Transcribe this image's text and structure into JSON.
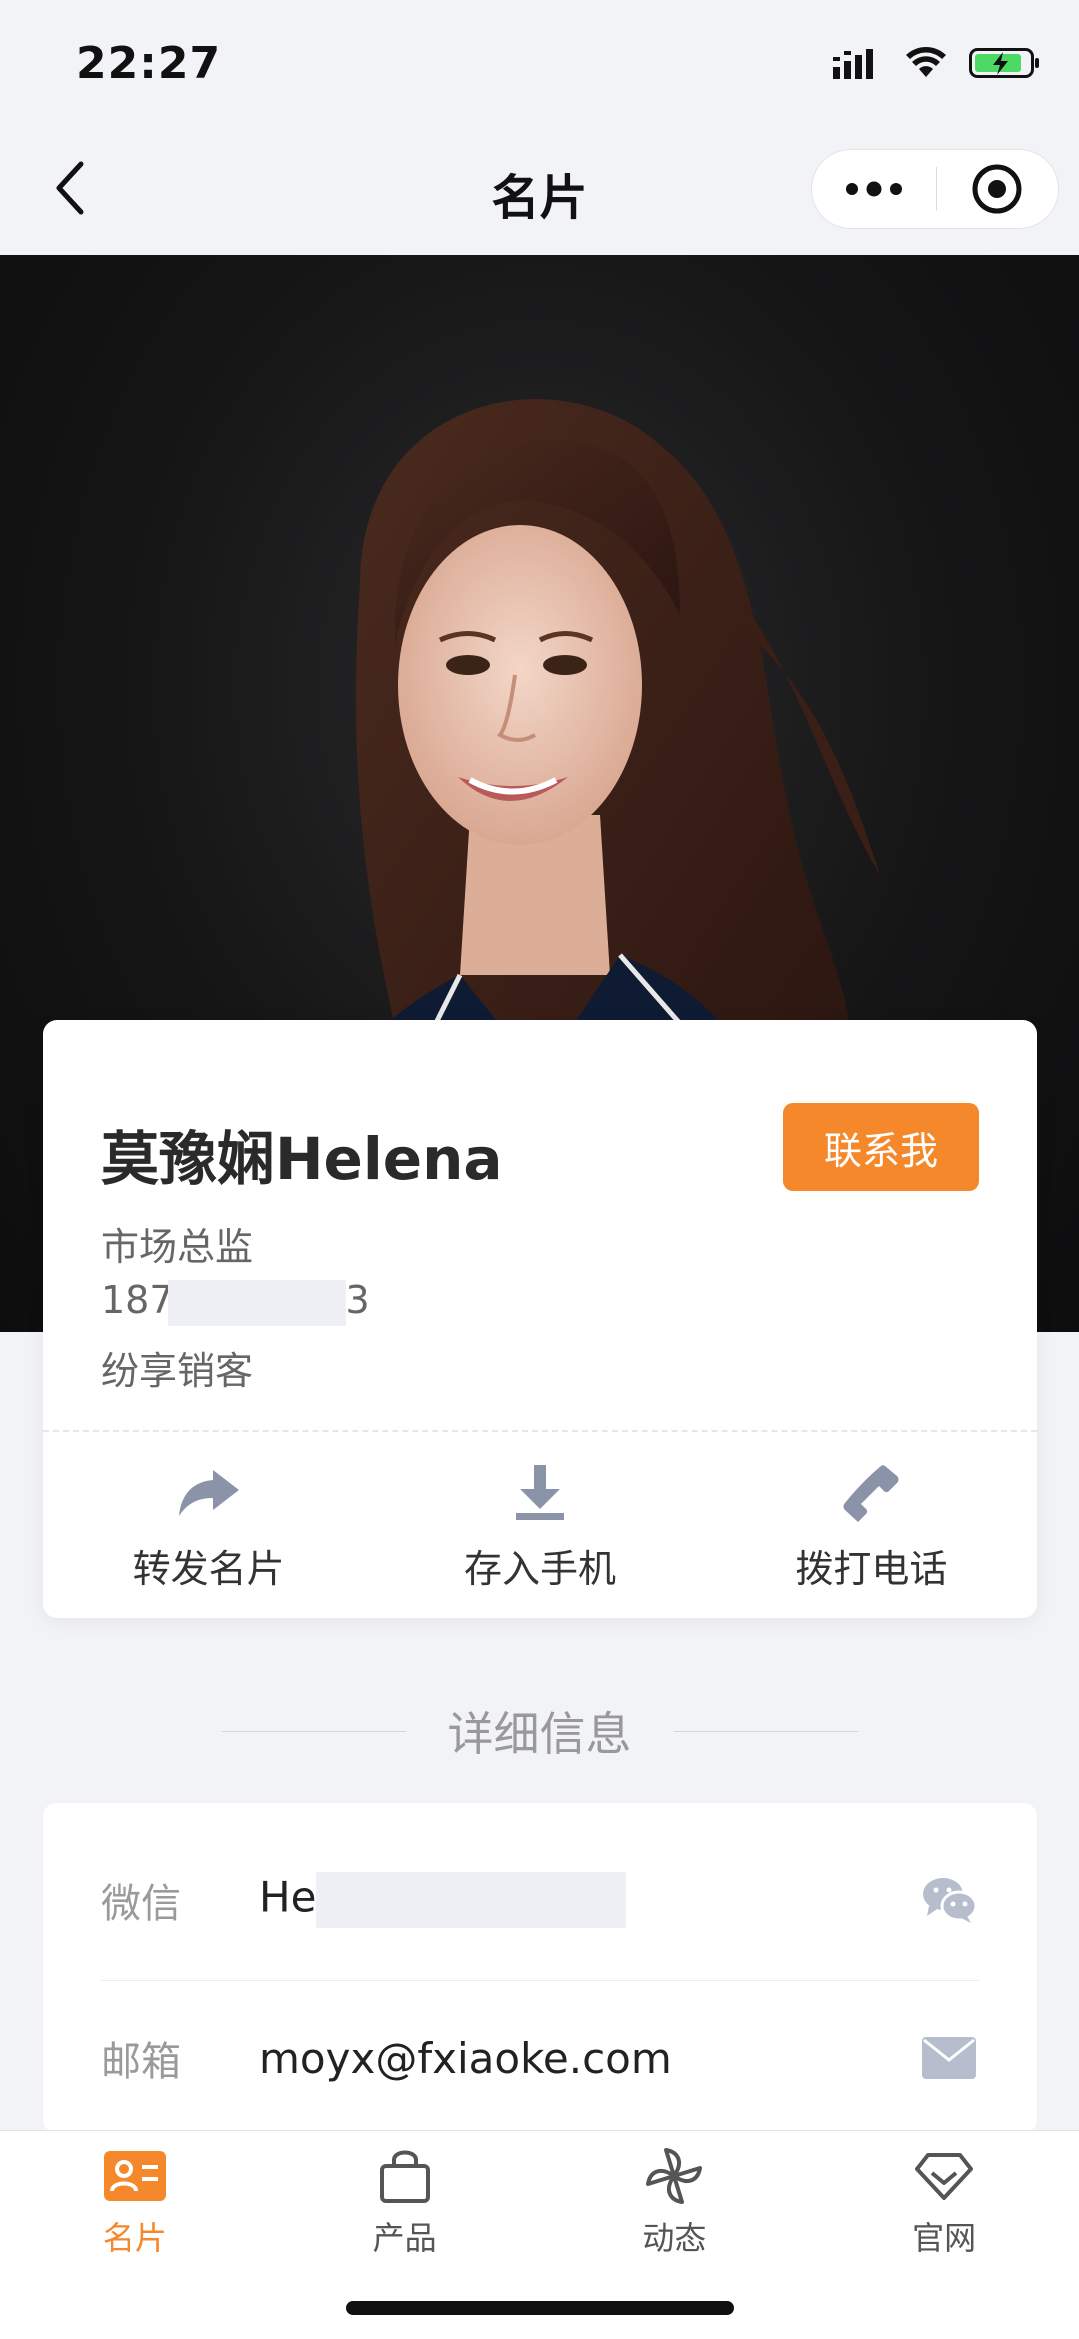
{
  "status_bar": {
    "time": "22:27"
  },
  "nav": {
    "title": "名片"
  },
  "card": {
    "name": "莫豫娴Helena",
    "contact_button": "联系我",
    "position": "市场总监",
    "phone_prefix": "187",
    "phone_suffix": "3",
    "company": "纷享销客",
    "actions": [
      {
        "label": "转发名片",
        "icon": "share-icon"
      },
      {
        "label": "存入手机",
        "icon": "download-icon"
      },
      {
        "label": "拨打电话",
        "icon": "phone-icon"
      }
    ]
  },
  "details": {
    "section_title": "详细信息",
    "rows": [
      {
        "label": "微信",
        "value": "He",
        "icon": "wechat-icon"
      },
      {
        "label": "邮箱",
        "value": "moyx@fxiaoke.com",
        "icon": "mail-icon"
      }
    ]
  },
  "tabbar": {
    "tabs": [
      {
        "label": "名片",
        "icon": "card-icon",
        "active": true
      },
      {
        "label": "产品",
        "icon": "bag-icon",
        "active": false
      },
      {
        "label": "动态",
        "icon": "pinwheel-icon",
        "active": false
      },
      {
        "label": "官网",
        "icon": "diamond-icon",
        "active": false
      }
    ]
  },
  "colors": {
    "accent": "#f5882a",
    "icon_gray": "#8a93a8",
    "background": "#f2f3f7"
  }
}
